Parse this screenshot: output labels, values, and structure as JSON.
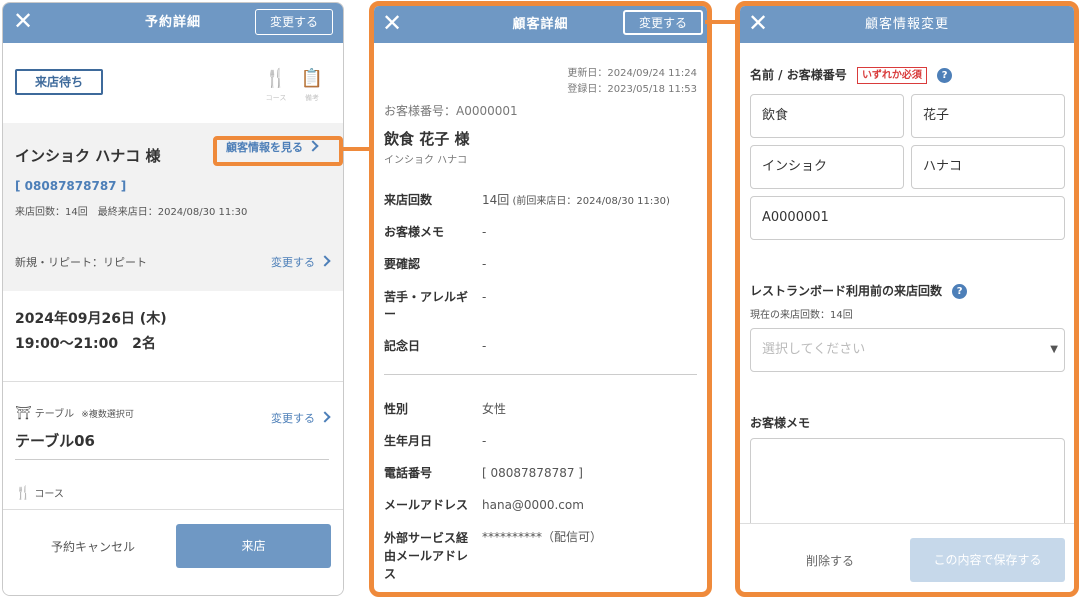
{
  "panel1": {
    "header": {
      "title": "予約詳細",
      "change_label": "変更する"
    },
    "status": "来店待ち",
    "icons": [
      {
        "name": "course-icon",
        "label": "コース"
      },
      {
        "name": "memo-icon",
        "label": "備考"
      }
    ],
    "customer": {
      "name": "インショク ハナコ 様",
      "view_link": "顧客情報を見る",
      "phone": "08087878787",
      "visit_info": "来店回数：14回　最終来店日：2024/08/30 11:30"
    },
    "repeat": {
      "label": "新規・リピート：リピート",
      "change_label": "変更する"
    },
    "reservation": {
      "date": "2024年09月26日 (木)",
      "time": "19:00～21:00　2名"
    },
    "table": {
      "label": "テーブル",
      "note": "※複数選択可",
      "change_label": "変更する",
      "value": "テーブル06"
    },
    "course": {
      "label": "コース"
    },
    "footer": {
      "cancel": "予約キャンセル",
      "visit": "来店"
    }
  },
  "panel2": {
    "header": {
      "title": "顧客詳細",
      "change_label": "変更する"
    },
    "updated": "更新日：2024/09/24 11:24",
    "registered": "登録日：2023/05/18 11:53",
    "customer_no": "お客様番号：A0000001",
    "name": "飲食 花子 様",
    "kana": "インショク ハナコ",
    "rows": [
      {
        "key": "来店回数",
        "value": "14回",
        "extra": " (前回来店日：2024/08/30 11:30)"
      },
      {
        "key": "お客様メモ",
        "value": "-"
      },
      {
        "key": "要確認",
        "value": "-"
      },
      {
        "key": "苦手・アレルギー",
        "value": "-"
      },
      {
        "key": "記念日",
        "value": "-"
      }
    ],
    "rows2": [
      {
        "key": "性別",
        "value": "女性"
      },
      {
        "key": "生年月日",
        "value": "-"
      },
      {
        "key": "電話番号",
        "value": "[ 08087878787 ]"
      },
      {
        "key": "メールアドレス",
        "value": "hana@0000.com"
      },
      {
        "key": "外部サービス経由メールアドレス",
        "value": "**********（配信可）"
      }
    ]
  },
  "panel3": {
    "header": {
      "title": "顧客情報変更"
    },
    "name_section": {
      "label": "名前 / お客様番号",
      "required": "いずれか必須"
    },
    "inputs": {
      "last_name": "飲食",
      "first_name": "花子",
      "last_kana": "インショク",
      "first_kana": "ハナコ",
      "customer_no": "A0000001"
    },
    "visit_section": {
      "label": "レストランボード利用前の来店回数",
      "current": "現在の来店回数：14回",
      "placeholder": "選択してください"
    },
    "memo_section": {
      "label": "お客様メモ"
    },
    "footer": {
      "delete": "削除する",
      "save": "この内容で保存する"
    }
  },
  "colors": {
    "header": "#6f98c4",
    "accent": "#ef8a3b",
    "link": "#4d7fb8",
    "required": "#d93b3b"
  }
}
